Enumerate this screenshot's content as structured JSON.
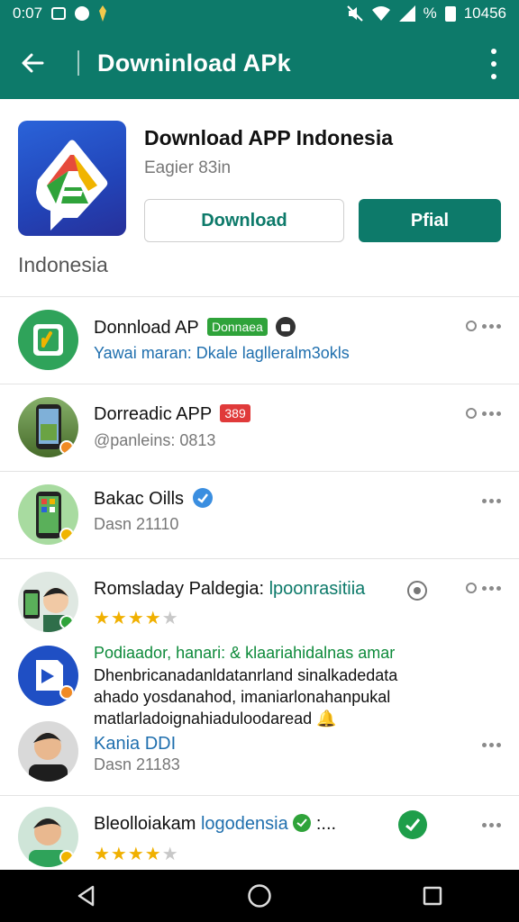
{
  "status_bar": {
    "time": "0:07",
    "right_text_1": "%",
    "right_text_2": "10456"
  },
  "app_bar": {
    "title": "Downinload APk",
    "back_icon": "arrow-left-icon",
    "menu_icon": "more-vert-icon"
  },
  "hero": {
    "app_name": "Download APP Indonesia",
    "meta": "Eagier 83in",
    "download_label": "Download",
    "primary_label": "Pfial",
    "region": "Indonesia"
  },
  "items": [
    {
      "name": "Donnload AP",
      "tag": "Donnaea",
      "sub": "Yawai maran: Dkale laglleralm3okls"
    },
    {
      "name": "Dorreadic APP",
      "tag": "389",
      "sub": "@panleins: 0813"
    },
    {
      "name": "Bakac Oills",
      "sub": "Dasn 21110"
    },
    {
      "name": "Romsladay Paldegia:",
      "name_extra": "lpoonrasitiia",
      "rating": 4
    },
    {
      "line1": "Podiaador, hanari: & klaariahidalnas amar",
      "line2": "Dhenbricanadanldatanrland sinalkadedata",
      "line3": "ahado yosdanahod, imaniarlonahanpukal",
      "line4": "matlarladoignahiaduloodaread"
    },
    {
      "name": "Kania DDI",
      "sub": "Dasn 21183"
    },
    {
      "name": "Bleolloiakam",
      "name_extra": "logodensia",
      "suffix": ":...",
      "rating": 4
    }
  ],
  "colors": {
    "primary": "#0d7a6a",
    "star": "#f0b000",
    "link": "#1f6fae"
  }
}
